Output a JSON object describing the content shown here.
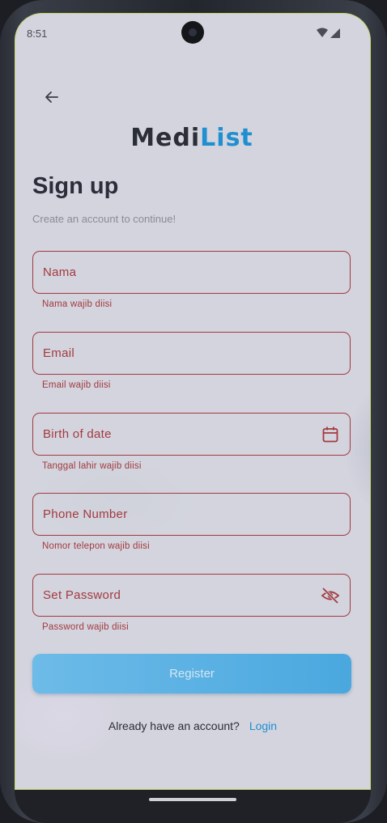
{
  "status_bar": {
    "time": "8:51"
  },
  "logo": {
    "part1": "Medi",
    "part2": "List"
  },
  "header": {
    "title": "Sign up",
    "subtitle": "Create an account to continue!"
  },
  "form": {
    "name": {
      "label": "Nama",
      "error": "Nama wajib diisi"
    },
    "email": {
      "label": "Email",
      "error": "Email wajib diisi"
    },
    "birth": {
      "label": "Birth of date",
      "error": "Tanggal lahir wajib diisi"
    },
    "phone": {
      "label": "Phone Number",
      "error": "Nomor telepon wajib diisi"
    },
    "password": {
      "label": "Set Password",
      "error": "Password wajib diisi"
    },
    "register_label": "Register"
  },
  "footer": {
    "text": "Already have an account?",
    "link": "Login"
  },
  "colors": {
    "error": "#a33a3f",
    "accent": "#1f8fd0",
    "button": "#4aa8df",
    "background": "#d3d4de"
  },
  "icons": [
    "back-arrow-icon",
    "calendar-icon",
    "visibility-off-icon",
    "wifi-icon",
    "signal-icon"
  ]
}
